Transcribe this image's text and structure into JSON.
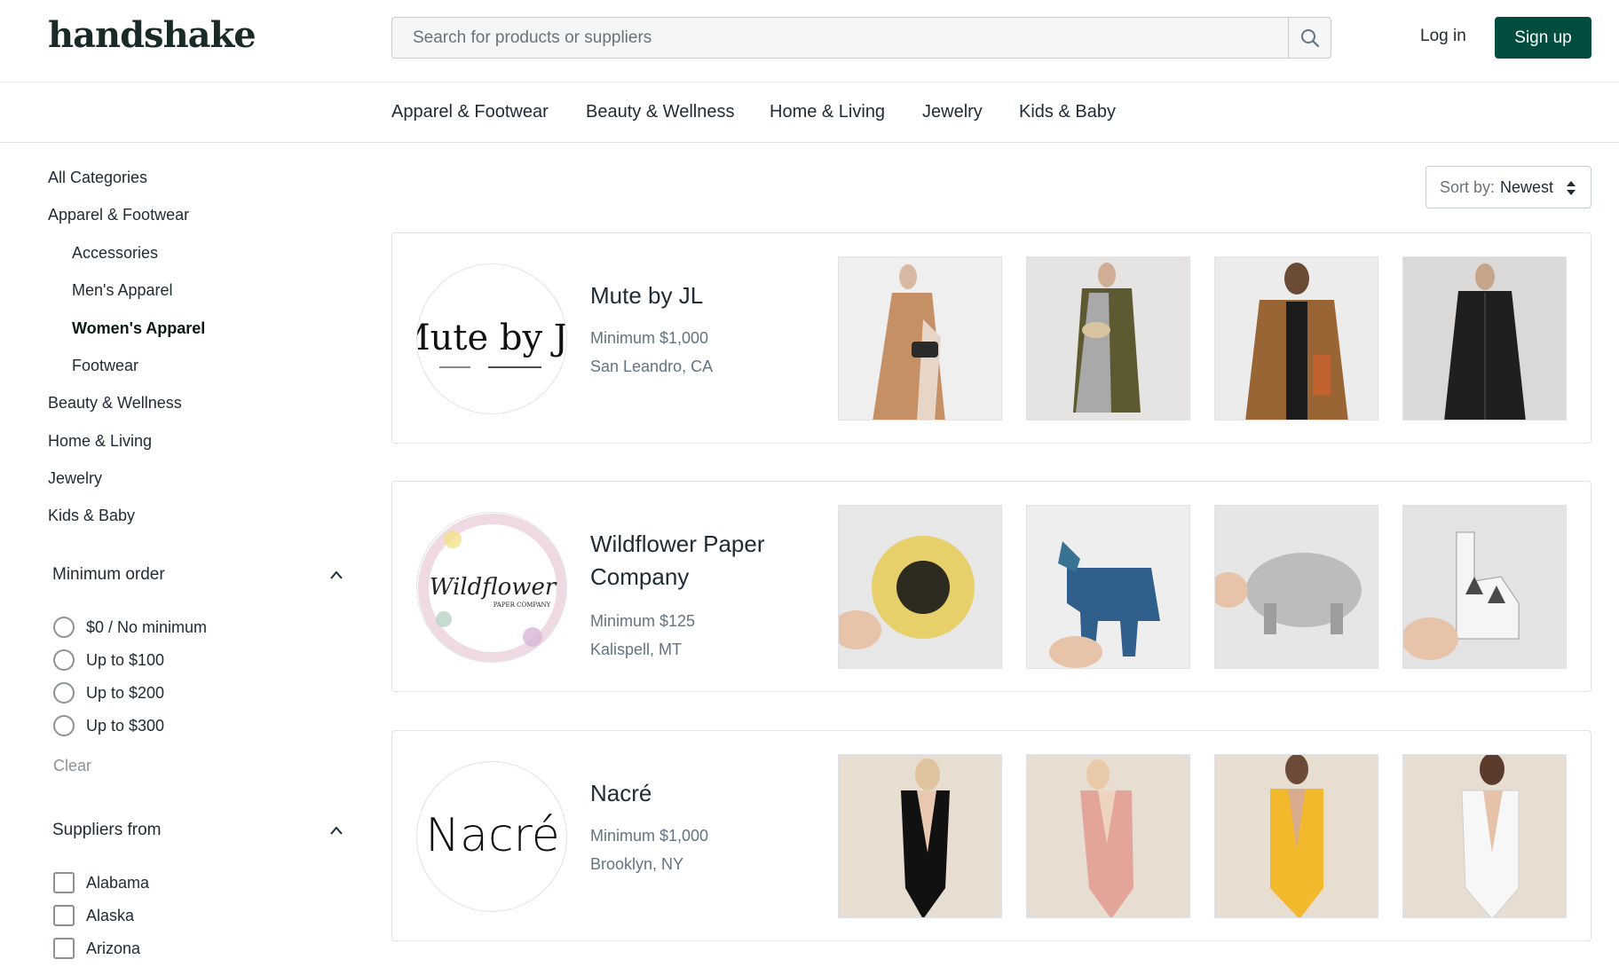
{
  "header": {
    "logo": "handshake",
    "search_placeholder": "Search for products or suppliers",
    "login_label": "Log in",
    "signup_label": "Sign up"
  },
  "catnav": [
    "Apparel & Footwear",
    "Beauty & Wellness",
    "Home & Living",
    "Jewelry",
    "Kids & Baby"
  ],
  "sidebar": {
    "categories": [
      {
        "label": "All Categories"
      },
      {
        "label": "Apparel & Footwear"
      },
      {
        "label": "Accessories"
      },
      {
        "label": "Men's Apparel"
      },
      {
        "label": "Women's Apparel"
      },
      {
        "label": "Footwear"
      },
      {
        "label": "Beauty & Wellness"
      },
      {
        "label": "Home & Living"
      },
      {
        "label": "Jewelry"
      },
      {
        "label": "Kids & Baby"
      }
    ],
    "minimum_order": {
      "title": "Minimum order",
      "options": [
        "$0 / No minimum",
        "Up to $100",
        "Up to $200",
        "Up to $300"
      ],
      "clear_label": "Clear"
    },
    "suppliers_from": {
      "title": "Suppliers from",
      "options": [
        "Alabama",
        "Alaska",
        "Arizona"
      ]
    }
  },
  "sort": {
    "label": "Sort by:",
    "value": "Newest"
  },
  "suppliers": [
    {
      "name": "Mute by JL",
      "logo_text": "Mute by JL",
      "minimum": "Minimum $1,000",
      "location": "San Leandro, CA"
    },
    {
      "name": "Wildflower Paper Company",
      "logo_text": "Wildflower",
      "logo_subtext": "PAPER COMPANY",
      "minimum": "Minimum $125",
      "location": "Kalispell, MT"
    },
    {
      "name": "Nacré",
      "logo_text": "Nacré",
      "minimum": "Minimum $1,000",
      "location": "Brooklyn, NY"
    }
  ],
  "colors": {
    "brand": "#004c3f",
    "text": "#212b36",
    "muted": "#637381",
    "border": "#dfe3e8"
  }
}
